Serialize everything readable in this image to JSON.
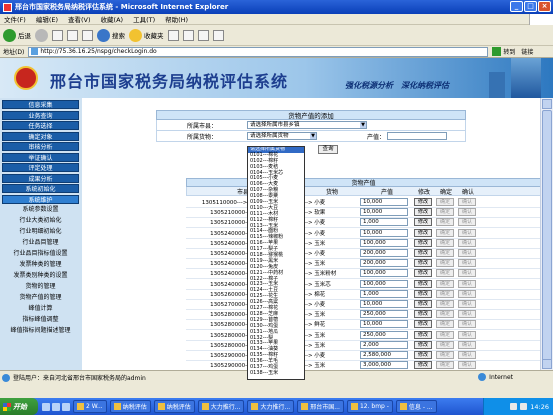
{
  "window": {
    "title": "邢台市国家税务局纳税评估系统 - Microsoft Internet Explorer",
    "buttons": [
      "_",
      "□",
      "×"
    ]
  },
  "menu": [
    "文件(F)",
    "编辑(E)",
    "查看(V)",
    "收藏(A)",
    "工具(T)",
    "帮助(H)"
  ],
  "toolbar": {
    "back": "后退",
    "search": "搜索",
    "favorites": "收藏夹"
  },
  "address": {
    "label": "地址(D)",
    "url": "http://75.36.16.25/nspg/checkLogin.do",
    "go": "转到",
    "links": "链接"
  },
  "header": {
    "title": "邢台市国家税务局纳税评估系统",
    "slogan": "强化税源分析　深化纳税评估"
  },
  "sidebar": {
    "items": [
      {
        "label": "信息采集",
        "style": "nav"
      },
      {
        "label": "业务查询",
        "style": "nav"
      },
      {
        "label": "任务选择",
        "style": "nav"
      },
      {
        "label": "确定对象",
        "style": "nav"
      },
      {
        "label": "审核分析",
        "style": "nav"
      },
      {
        "label": "举证确认",
        "style": "nav"
      },
      {
        "label": "评定处理",
        "style": "nav"
      },
      {
        "label": "成果分析",
        "style": "nav"
      },
      {
        "label": "系统初始化",
        "style": "nav"
      },
      {
        "label": "系统维护",
        "style": "active"
      },
      {
        "label": "系统参数设置",
        "style": "plain"
      },
      {
        "label": "行业大类初始化",
        "style": "plain"
      },
      {
        "label": "行业明细初始化",
        "style": "plain"
      },
      {
        "label": "行业品目管理",
        "style": "plain"
      },
      {
        "label": "行业品目指标值设置",
        "style": "plain"
      },
      {
        "label": "发票种类的管理",
        "style": "plain"
      },
      {
        "label": "发票类别种类的设置",
        "style": "plain"
      },
      {
        "label": "货物的管理",
        "style": "plain"
      },
      {
        "label": "货物产值的管理",
        "style": "plain"
      },
      {
        "label": "峰值计算",
        "style": "plain"
      },
      {
        "label": "指标峰值调整",
        "style": "plain"
      },
      {
        "label": "峰值指标间题描述管理",
        "style": "plain"
      }
    ],
    "logout": "退出登录"
  },
  "form": {
    "title": "货物产值的添加",
    "city_label": "所属市县：",
    "city_value": "请选择所属市县乡镇",
    "goods_label": "所属货物：",
    "goods_value": "请选择所属货物",
    "output_label": "产值：",
    "query": "查询"
  },
  "dropdown": {
    "items": [
      "请选择所属货物",
      "0101---棉花",
      "0102---棉籽",
      "0103---麦秸",
      "0104---玉米芯",
      "0105---小麦",
      "0106---大麦",
      "0107---杂粮",
      "0108---黍粟",
      "0109---玉米",
      "0110---大豆",
      "0111---木材",
      "0112---棉籽",
      "0113---玉米",
      "0114---面粉",
      "0115---辣椒粉",
      "0116---苹果",
      "0117---梨子",
      "0118---猕猴桃",
      "0119---黑米",
      "0120---兔皮",
      "0121---中药材",
      "0122---棉子",
      "0123---玉米",
      "0124---土豆",
      "0125---花生",
      "0126---高粱",
      "0127---棉花",
      "0128---芝麻",
      "0129---苜蓿",
      "0130---鸡蛋",
      "0131---地瓜",
      "0132---梨",
      "0133---苹果",
      "0134---油葵",
      "0135---棉籽",
      "0136---羊毛",
      "0137---鸡蛋",
      "0138---玉米"
    ],
    "selected_index": 0
  },
  "list": {
    "title": "货物产值",
    "headers": {
      "city": "市县",
      "goods": "货物",
      "output": "产值",
      "edit": "修改",
      "confirm": "确定",
      "check": "确认"
    },
    "edit_label": "修改",
    "confirm_label": "确定",
    "check_label": "确认",
    "rows": [
      {
        "city": "1305110000---> 邢台市高新区",
        "goods": "---> 小麦",
        "output": "10,000"
      },
      {
        "city": "1305210000---> 邢台县",
        "goods": "---> 软果",
        "output": "10,000"
      },
      {
        "city": "1305210000---> 邢台县",
        "goods": "---> 小麦",
        "output": "1,000"
      },
      {
        "city": "1305240000---> 柏乡县",
        "goods": "---> 小麦",
        "output": "10,000"
      },
      {
        "city": "1305240000---> 柏乡县",
        "goods": "---> 玉米",
        "output": "100,000"
      },
      {
        "city": "1305240000---> 柏乡县",
        "goods": "---> 小麦",
        "output": "200,000"
      },
      {
        "city": "1305240000---> 柏乡县",
        "goods": "---> 玉米",
        "output": "200,000"
      },
      {
        "city": "1305240000---> 柏乡县",
        "goods": "---> 玉米粉材",
        "output": "100,000"
      },
      {
        "city": "1305240000---> 柏乡县",
        "goods": "---> 玉米芯",
        "output": "100,000"
      },
      {
        "city": "1305260000---> 南和县",
        "goods": "---> 棉花",
        "output": "1,000"
      },
      {
        "city": "1305270000---> 南和县",
        "goods": "---> 小麦",
        "output": "10,000"
      },
      {
        "city": "1305280000---> 宁晋县",
        "goods": "---> 玉米",
        "output": "250,000"
      },
      {
        "city": "1305280000---> 宁晋县",
        "goods": "---> 鲜花",
        "output": "10,000"
      },
      {
        "city": "1305280000---> 宁晋县",
        "goods": "---> 玉米",
        "output": "250,000"
      },
      {
        "city": "1305280000---> 宁晋县",
        "goods": "---> 玉米",
        "output": "2,000"
      },
      {
        "city": "1305290000---> 巨鹿县",
        "goods": "---> 小麦",
        "output": "2,580,000"
      },
      {
        "city": "1305290000---> 巨鹿县",
        "goods": "---> 玉米",
        "output": "3,000,000"
      }
    ]
  },
  "status": {
    "left": "登陆用户：来自河北省邢台市国家税务局的admin",
    "zone": "Internet"
  },
  "taskbar": {
    "start": "开始",
    "tasks": [
      "2 W...",
      "纳税评估",
      "纳税评估",
      "大力推行...",
      "大力推行...",
      "邢台市国...",
      "12. bmp -",
      "信息 - ..."
    ],
    "clock": "14:26"
  },
  "colors": {
    "accent": "#1a5da7",
    "title_bar": "#2a63d8",
    "header_text": "#1d3e8f"
  }
}
